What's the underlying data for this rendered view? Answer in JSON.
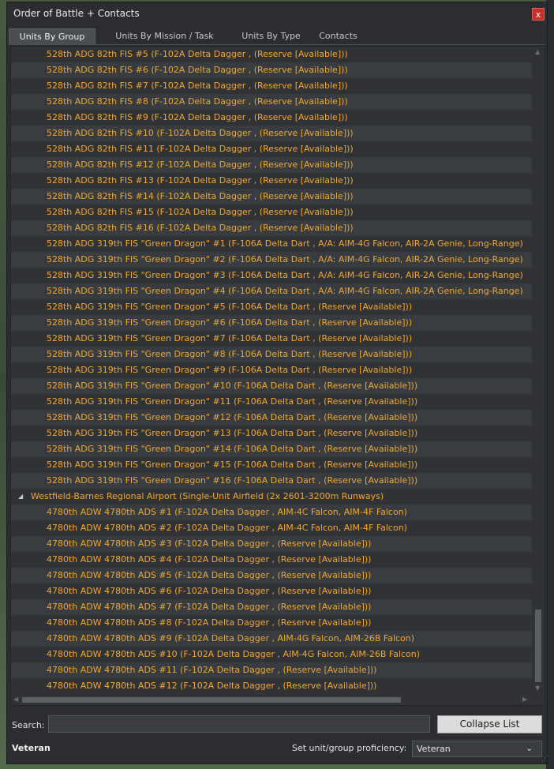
{
  "window": {
    "title": "Order of Battle + Contacts",
    "close_label": "x"
  },
  "tabs": [
    {
      "label": "Units By Group",
      "active": true
    },
    {
      "label": "Units By Mission / Task",
      "active": false
    },
    {
      "label": "Units By Type",
      "active": false
    },
    {
      "label": "Contacts",
      "active": false
    }
  ],
  "tree_rows": [
    {
      "text": "528th ADG 82th FIS #5 (F-102A Delta Dagger , (Reserve [Available]))",
      "level": 1
    },
    {
      "text": "528th ADG 82th FIS #6 (F-102A Delta Dagger , (Reserve [Available]))",
      "level": 1
    },
    {
      "text": "528th ADG 82th FIS #7 (F-102A Delta Dagger , (Reserve [Available]))",
      "level": 1
    },
    {
      "text": "528th ADG 82th FIS #8 (F-102A Delta Dagger , (Reserve [Available]))",
      "level": 1
    },
    {
      "text": "528th ADG 82th FIS #9 (F-102A Delta Dagger , (Reserve [Available]))",
      "level": 1
    },
    {
      "text": "528th ADG 82th FIS #10 (F-102A Delta Dagger , (Reserve [Available]))",
      "level": 1
    },
    {
      "text": "528th ADG 82th FIS #11 (F-102A Delta Dagger , (Reserve [Available]))",
      "level": 1
    },
    {
      "text": "528th ADG 82th FIS #12 (F-102A Delta Dagger , (Reserve [Available]))",
      "level": 1
    },
    {
      "text": "528th ADG 82th FIS #13 (F-102A Delta Dagger , (Reserve [Available]))",
      "level": 1
    },
    {
      "text": "528th ADG 82th FIS #14 (F-102A Delta Dagger , (Reserve [Available]))",
      "level": 1
    },
    {
      "text": "528th ADG 82th FIS #15 (F-102A Delta Dagger , (Reserve [Available]))",
      "level": 1
    },
    {
      "text": "528th ADG 82th FIS #16 (F-102A Delta Dagger , (Reserve [Available]))",
      "level": 1
    },
    {
      "text": "528th ADG 319th FIS \"Green Dragon\" #1 (F-106A Delta Dart , A/A: AIM-4G Falcon, AIR-2A Genie, Long-Range)",
      "level": 1
    },
    {
      "text": "528th ADG 319th FIS \"Green Dragon\" #2 (F-106A Delta Dart , A/A: AIM-4G Falcon, AIR-2A Genie, Long-Range)",
      "level": 1
    },
    {
      "text": "528th ADG 319th FIS \"Green Dragon\" #3 (F-106A Delta Dart , A/A: AIM-4G Falcon, AIR-2A Genie, Long-Range)",
      "level": 1
    },
    {
      "text": "528th ADG 319th FIS \"Green Dragon\" #4 (F-106A Delta Dart , A/A: AIM-4G Falcon, AIR-2A Genie, Long-Range)",
      "level": 1
    },
    {
      "text": "528th ADG 319th FIS \"Green Dragon\" #5 (F-106A Delta Dart , (Reserve [Available]))",
      "level": 1
    },
    {
      "text": "528th ADG 319th FIS \"Green Dragon\" #6 (F-106A Delta Dart , (Reserve [Available]))",
      "level": 1
    },
    {
      "text": "528th ADG 319th FIS \"Green Dragon\" #7 (F-106A Delta Dart , (Reserve [Available]))",
      "level": 1
    },
    {
      "text": "528th ADG 319th FIS \"Green Dragon\" #8 (F-106A Delta Dart , (Reserve [Available]))",
      "level": 1
    },
    {
      "text": "528th ADG 319th FIS \"Green Dragon\" #9 (F-106A Delta Dart , (Reserve [Available]))",
      "level": 1
    },
    {
      "text": "528th ADG 319th FIS \"Green Dragon\" #10 (F-106A Delta Dart , (Reserve [Available]))",
      "level": 1
    },
    {
      "text": "528th ADG 319th FIS \"Green Dragon\" #11 (F-106A Delta Dart , (Reserve [Available]))",
      "level": 1
    },
    {
      "text": "528th ADG 319th FIS \"Green Dragon\" #12 (F-106A Delta Dart , (Reserve [Available]))",
      "level": 1
    },
    {
      "text": "528th ADG 319th FIS \"Green Dragon\" #13 (F-106A Delta Dart , (Reserve [Available]))",
      "level": 1
    },
    {
      "text": "528th ADG 319th FIS \"Green Dragon\" #14 (F-106A Delta Dart , (Reserve [Available]))",
      "level": 1
    },
    {
      "text": "528th ADG 319th FIS \"Green Dragon\" #15 (F-106A Delta Dart , (Reserve [Available]))",
      "level": 1
    },
    {
      "text": "528th ADG 319th FIS \"Green Dragon\" #16 (F-106A Delta Dart , (Reserve [Available]))",
      "level": 1
    },
    {
      "text": "Westfield-Barnes Regional Airport (Single-Unit Airfield (2x 2601-3200m Runways)",
      "level": 0,
      "expander": "chevron-expanded-icon"
    },
    {
      "text": "4780th ADW 4780th ADS #1 (F-102A Delta Dagger , AIM-4C Falcon, AIM-4F Falcon)",
      "level": 1
    },
    {
      "text": "4780th ADW 4780th ADS #2 (F-102A Delta Dagger , AIM-4C Falcon, AIM-4F Falcon)",
      "level": 1
    },
    {
      "text": "4780th ADW 4780th ADS #3 (F-102A Delta Dagger , (Reserve [Available]))",
      "level": 1
    },
    {
      "text": "4780th ADW 4780th ADS #4 (F-102A Delta Dagger , (Reserve [Available]))",
      "level": 1
    },
    {
      "text": "4780th ADW 4780th ADS #5 (F-102A Delta Dagger , (Reserve [Available]))",
      "level": 1
    },
    {
      "text": "4780th ADW 4780th ADS #6 (F-102A Delta Dagger , (Reserve [Available]))",
      "level": 1
    },
    {
      "text": "4780th ADW 4780th ADS #7 (F-102A Delta Dagger , (Reserve [Available]))",
      "level": 1
    },
    {
      "text": "4780th ADW 4780th ADS #8 (F-102A Delta Dagger , (Reserve [Available]))",
      "level": 1
    },
    {
      "text": "4780th ADW 4780th ADS #9 (F-102A Delta Dagger , AIM-4G Falcon, AIM-26B Falcon)",
      "level": 1
    },
    {
      "text": "4780th ADW 4780th ADS #10 (F-102A Delta Dagger , AIM-4G Falcon, AIM-26B Falcon)",
      "level": 1
    },
    {
      "text": "4780th ADW 4780th ADS #11 (F-102A Delta Dagger , (Reserve [Available]))",
      "level": 1
    },
    {
      "text": "4780th ADW 4780th ADS #12 (F-102A Delta Dagger , (Reserve [Available]))",
      "level": 1
    }
  ],
  "colors": {
    "unit_text": "#f0a830",
    "window_bg": "#2b2d30",
    "close_button": "#c9302c"
  },
  "footer": {
    "search_label": "Search:",
    "search_value": "",
    "collapse_label": "Collapse List",
    "proficiency_status": "Veteran",
    "set_proficiency_label": "Set unit/group proficiency:",
    "proficiency_selected": "Veteran"
  }
}
